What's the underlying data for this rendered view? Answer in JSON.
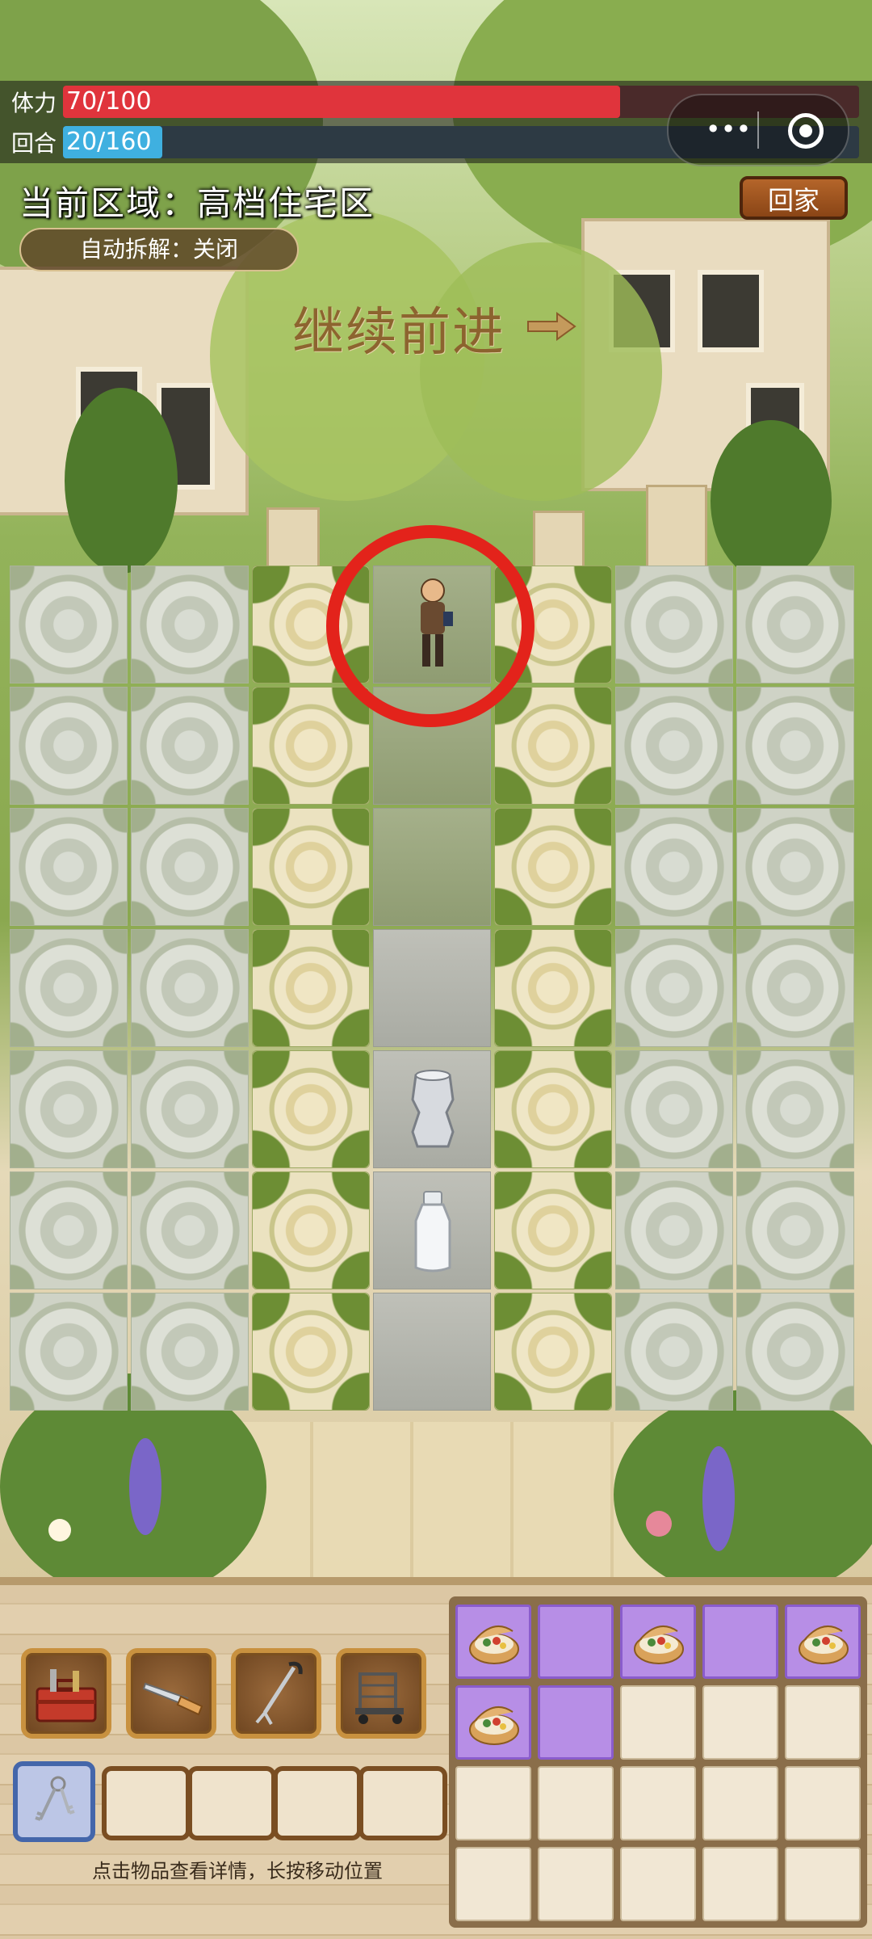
{
  "status": {
    "stamina_label": "体力",
    "stamina_text": "70/100",
    "stamina_value": 70,
    "stamina_max": 100,
    "turn_label": "回合",
    "turn_text": "20/160",
    "turn_value": 20,
    "turn_max": 160
  },
  "header": {
    "area_title": "当前区域：高档住宅区",
    "home_label": "回家",
    "auto_dismantle_label": "自动拆解：关闭",
    "forward_text": "继续前进"
  },
  "map": {
    "items": [
      {
        "name": "crushed-can-icon"
      },
      {
        "name": "glass-bottle-icon"
      }
    ]
  },
  "tools": [
    {
      "name": "toolbox-icon"
    },
    {
      "name": "pocket-knife-icon"
    },
    {
      "name": "grabber-tool-icon"
    },
    {
      "name": "hand-cart-icon"
    }
  ],
  "quick_slots": [
    {
      "name": "keys-icon",
      "selected": true
    },
    {
      "name": "empty-slot"
    },
    {
      "name": "empty-slot"
    },
    {
      "name": "empty-slot"
    },
    {
      "name": "empty-slot"
    }
  ],
  "hint": "点击物品查看详情，长按移动位置",
  "inventory_icon": "lunch-basket-icon",
  "colors": {
    "stamina": "#e0343c",
    "turn": "#3fb0e0",
    "highlight": "#e3231b",
    "bag_used": "#b78ee6"
  }
}
